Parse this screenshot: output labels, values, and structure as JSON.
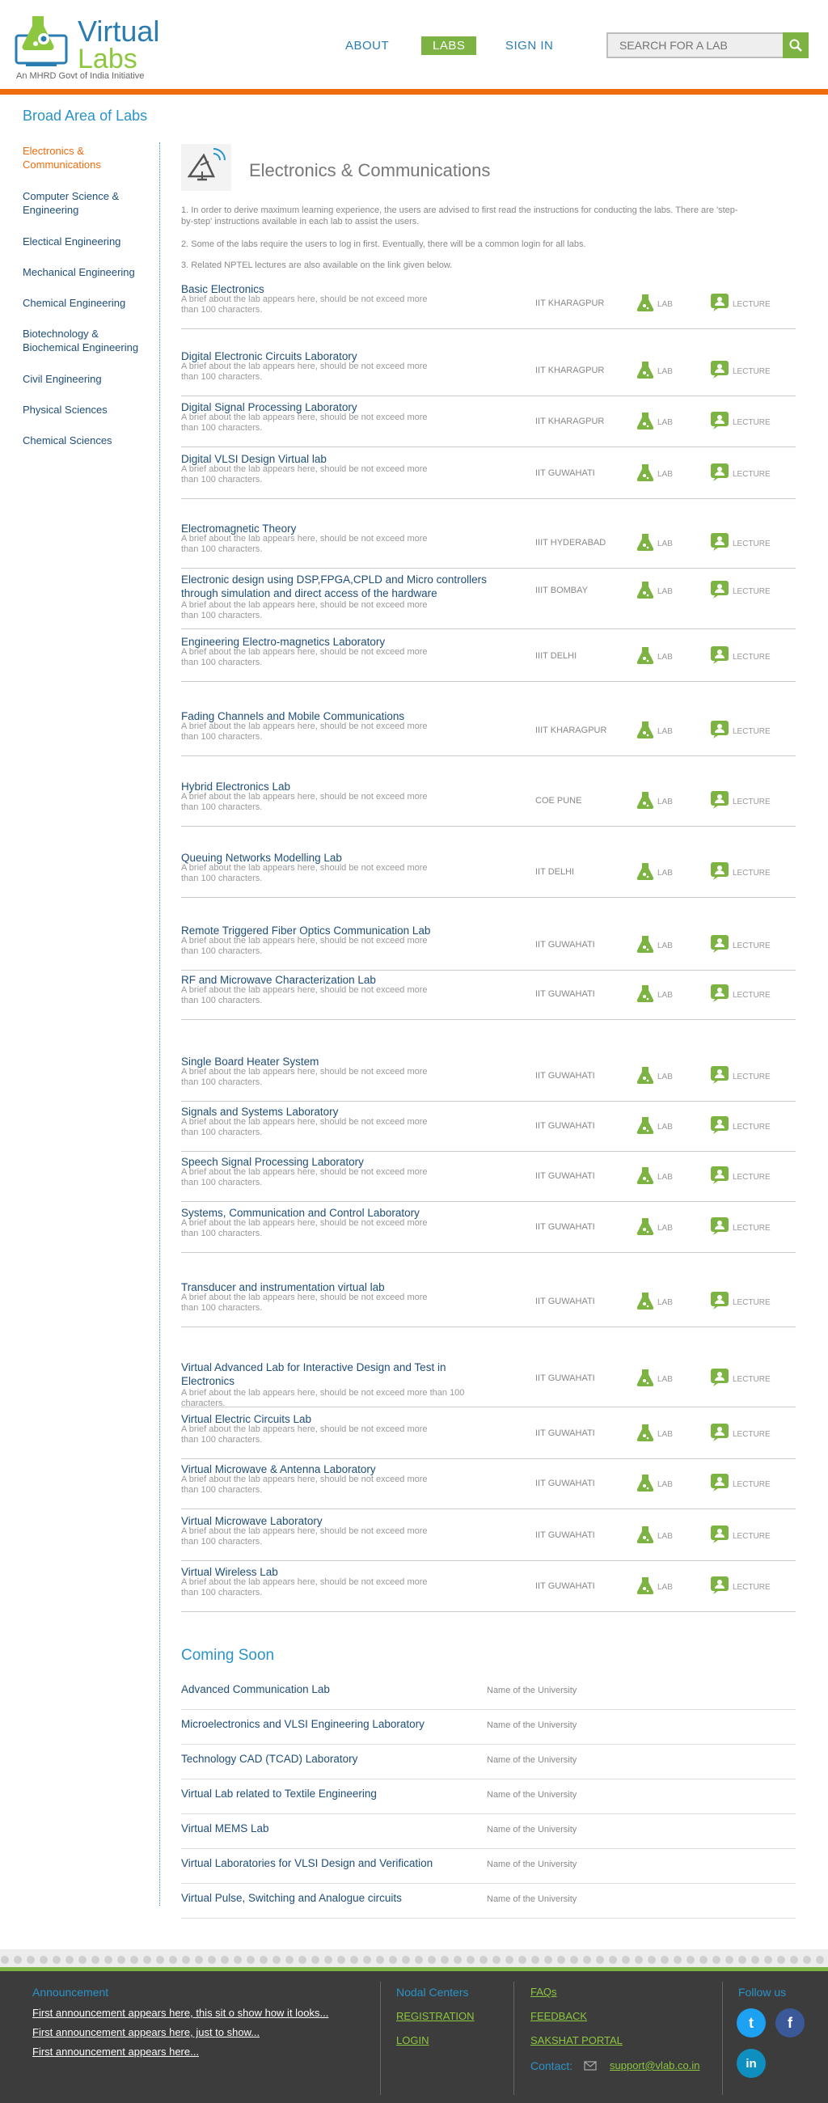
{
  "header": {
    "logo_title": "Virtual",
    "logo_subtitle": "Labs",
    "logo_tag": "An MHRD Govt of India Initiative",
    "nav": {
      "about": "ABOUT",
      "labs": "LABS",
      "signin": "SIGN IN"
    },
    "search_placeholder": "SEARCH FOR A LAB"
  },
  "sidebar": {
    "heading": "Broad Area of Labs",
    "items": [
      "Electronics & Communications",
      "Computer Science & Engineering",
      "Electical Engineering",
      "Mechanical Engineering",
      "Chemical Engineering",
      "Biotechnology & Biochemical Engineering",
      "Civil Engineering",
      "Physical Sciences",
      "Chemical Sciences"
    ]
  },
  "main": {
    "title": "Electronics & Communications",
    "instructions": [
      "1. In order to derive maximum learning experience, the users are advised to first read the instructions for conducting the labs. There are 'step-by-step' instructions available in each lab to assist the users.",
      "2. Some of the labs require the users to log in first. Eventually, there will be a common login for all labs.",
      "3. Related NPTEL lectures are also available on the link given below."
    ],
    "lab_label": "LAB",
    "lecture_label": "LECTURE",
    "labs": [
      {
        "name": "Basic Electronics",
        "brief": "A brief about the lab appears here, should be not exceed more than 100 characters.",
        "institute": "IIT KHARAGPUR"
      },
      {
        "name": "Digital Electronic Circuits Laboratory",
        "brief": "A brief about the lab appears here, should be not exceed more than 100 characters.",
        "institute": "IIT KHARAGPUR"
      },
      {
        "name": "Digital Signal Processing Laboratory",
        "brief": "A brief about the lab appears here, should be not exceed more than 100 characters.",
        "institute": "IIT KHARAGPUR"
      },
      {
        "name": "Digital VLSI Design Virtual lab",
        "brief": "A brief about the lab appears here, should be not exceed more than 100 characters.",
        "institute": "IIT GUWAHATI"
      },
      {
        "name": "Electromagnetic Theory",
        "brief": "A brief about the lab appears here, should be not exceed more than 100 characters.",
        "institute": "IIIT HYDERABAD"
      },
      {
        "name": "Electronic design using DSP,FPGA,CPLD and Micro controllers through simulation and direct access of the hardware",
        "brief": "A brief about the lab appears here, should be not exceed more than 100 characters.",
        "institute": "IIIT BOMBAY"
      },
      {
        "name": "Engineering Electro-magnetics Laboratory",
        "brief": "A brief about the lab appears here, should be not exceed more than 100 characters.",
        "institute": "IIIT DELHI"
      },
      {
        "name": "Fading Channels and Mobile Communications",
        "brief": "A brief about the lab appears here, should be not exceed more than 100 characters.",
        "institute": "IIIT KHARAGPUR"
      },
      {
        "name": "Hybrid Electronics Lab",
        "brief": "A brief about the lab appears here, should be not exceed more than 100 characters.",
        "institute": "COE PUNE"
      },
      {
        "name": "Queuing Networks Modelling Lab",
        "brief": "A brief about the lab appears here, should be not exceed more than 100 characters.",
        "institute": "IIT DELHI"
      },
      {
        "name": "Remote Triggered Fiber Optics Communication Lab",
        "brief": "A brief about the lab appears here, should be not exceed more than 100 characters.",
        "institute": "IIT GUWAHATI"
      },
      {
        "name": "RF and Microwave Characterization Lab",
        "brief": "A brief about the lab appears here, should be not exceed more than 100 characters.",
        "institute": "IIT GUWAHATI"
      },
      {
        "name": "Single Board Heater System",
        "brief": "A brief about the lab appears here, should be not exceed more than 100 characters.",
        "institute": "IIT GUWAHATI"
      },
      {
        "name": "Signals and Systems Laboratory",
        "brief": "A brief about the lab appears here, should be not exceed more than 100 characters.",
        "institute": "IIT GUWAHATI"
      },
      {
        "name": "Speech Signal Processing Laboratory",
        "brief": "A brief about the lab appears here, should be not exceed more than 100 characters.",
        "institute": "IIT GUWAHATI"
      },
      {
        "name": "Systems, Communication and Control Laboratory",
        "brief": "A brief about the lab appears here, should be not exceed more than 100 characters.",
        "institute": "IIT GUWAHATI"
      },
      {
        "name": "Transducer and instrumentation virtual lab",
        "brief": "A brief about the lab appears here, should be not exceed more than 100 characters.",
        "institute": "IIT GUWAHATI"
      },
      {
        "name": "Virtual Advanced Lab for Interactive Design and Test in Electronics",
        "brief": "A brief about the lab appears here, should be not exceed more than 100 characters.",
        "institute": "IIT GUWAHATI"
      },
      {
        "name": "Virtual Electric Circuits Lab",
        "brief": "A brief about the lab appears here, should be not exceed more than 100 characters.",
        "institute": "IIT GUWAHATI"
      },
      {
        "name": "Virtual Microwave & Antenna Laboratory",
        "brief": "A brief about the lab appears here, should be not exceed more than 100 characters.",
        "institute": "IIT GUWAHATI"
      },
      {
        "name": "Virtual Microwave Laboratory",
        "brief": "A brief about the lab appears here, should be not exceed more than 100 characters.",
        "institute": "IIT GUWAHATI"
      },
      {
        "name": "Virtual Wireless Lab",
        "brief": "A brief about the lab appears here, should be not exceed more than 100 characters.",
        "institute": "IIT GUWAHATI"
      }
    ],
    "coming_soon_title": "Coming Soon",
    "coming_soon": [
      {
        "name": "Advanced Communication Lab",
        "university": "Name of the University"
      },
      {
        "name": "Microelectronics and VLSI Engineering Laboratory",
        "university": "Name of the University"
      },
      {
        "name": "Technology CAD (TCAD) Laboratory",
        "university": "Name of the University"
      },
      {
        "name": "Virtual Lab related to Textile Engineering",
        "university": "Name of the University"
      },
      {
        "name": "Virtual MEMS Lab",
        "university": "Name of the University"
      },
      {
        "name": "Virtual Laboratories for VLSI Design and Verification",
        "university": "Name of the University"
      },
      {
        "name": "Virtual Pulse, Switching and Analogue circuits",
        "university": "Name of the University"
      }
    ]
  },
  "footer": {
    "announcement_heading": "Announcement",
    "announcements": [
      "First announcement appears here, this sit o show how it looks...",
      "First announcement appears here, just to show...",
      "First announcement appears here..."
    ],
    "nodal_centers": "Nodal Centers",
    "registration": "REGISTRATION",
    "login": "LOGIN",
    "faqs": "FAQs",
    "feedback": "FEEDBACK",
    "sakshat": "SAKSHAT PORTAL",
    "contact_label": "Contact:",
    "contact_email": "support@vlab.co.in",
    "follow_us": "Follow us",
    "social": {
      "twitter": "t",
      "facebook": "f",
      "linkedin": "in"
    }
  },
  "colors": {
    "brand_blue": "#2a7db0",
    "accent_green": "#7cb342",
    "accent_orange": "#ef6c0c",
    "footer_bg": "#3c3c3c"
  }
}
